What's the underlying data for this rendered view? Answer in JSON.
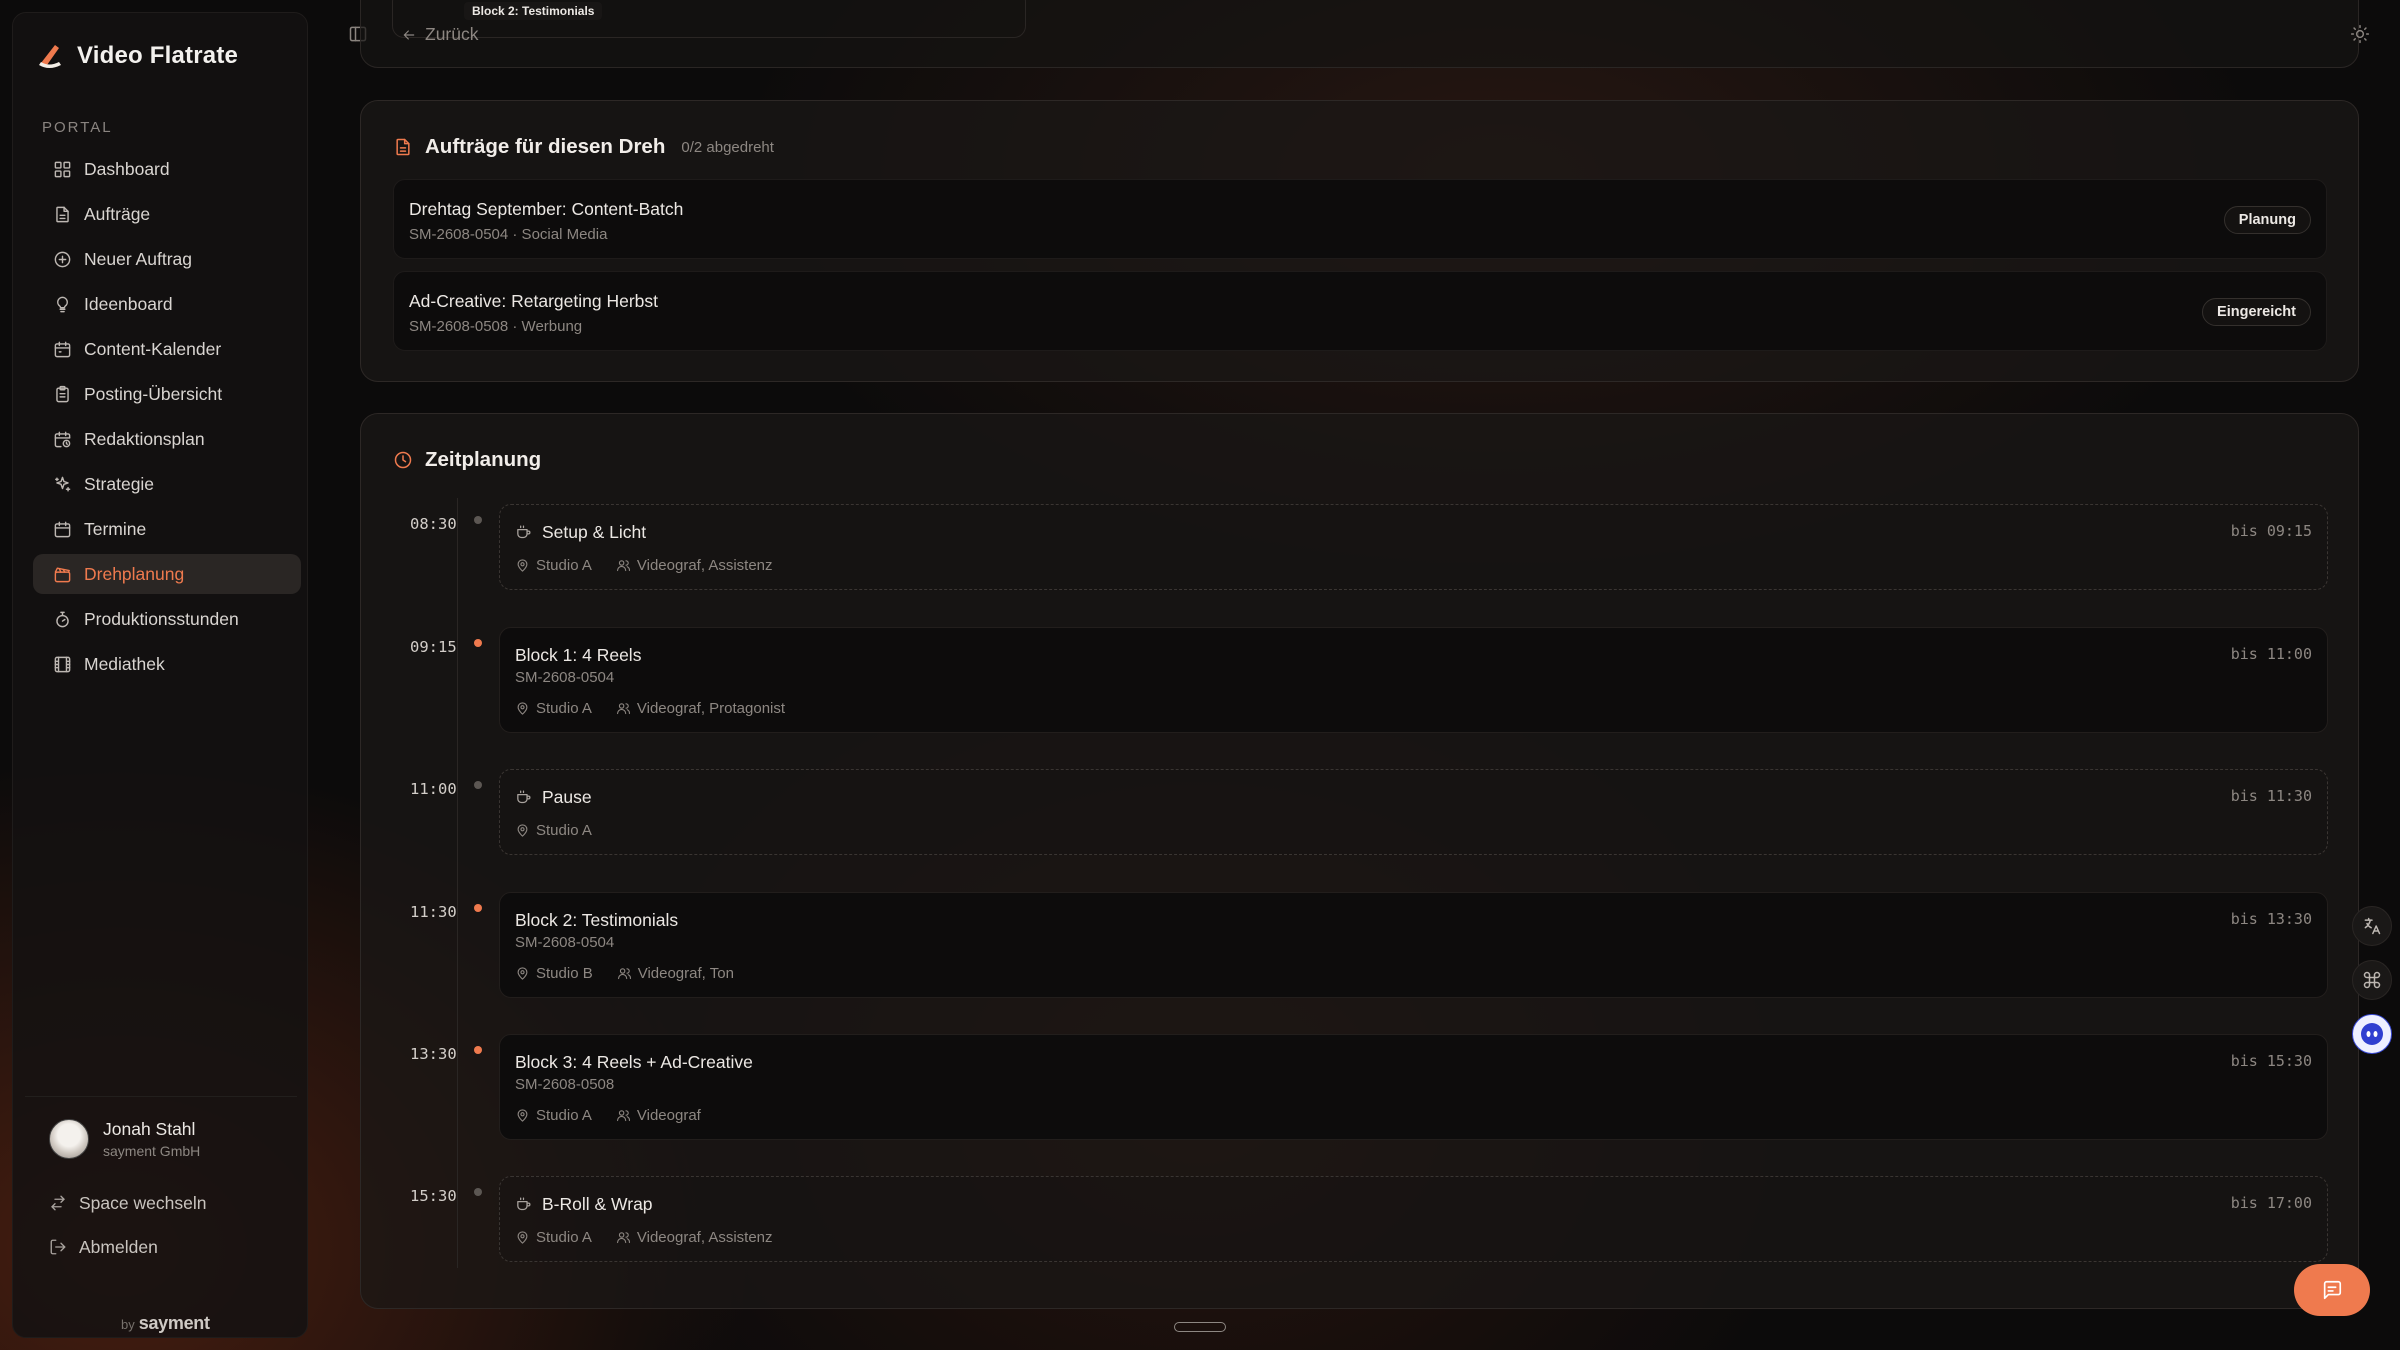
{
  "app": {
    "title": "Video Flatrate",
    "section_label": "PORTAL"
  },
  "sidebar": {
    "items": [
      {
        "label": "Dashboard",
        "icon": "grid-icon"
      },
      {
        "label": "Aufträge",
        "icon": "file-icon"
      },
      {
        "label": "Neuer Auftrag",
        "icon": "plus-circle-icon"
      },
      {
        "label": "Ideenboard",
        "icon": "lightbulb-icon"
      },
      {
        "label": "Content-Kalender",
        "icon": "calendar-icon"
      },
      {
        "label": "Posting-Übersicht",
        "icon": "clipboard-icon"
      },
      {
        "label": "Redaktionsplan",
        "icon": "calendar-clock-icon"
      },
      {
        "label": "Strategie",
        "icon": "sparkles-icon"
      },
      {
        "label": "Termine",
        "icon": "calendar-icon"
      },
      {
        "label": "Drehplanung",
        "icon": "clapperboard-icon",
        "active": true
      },
      {
        "label": "Produktionsstunden",
        "icon": "timer-icon"
      },
      {
        "label": "Mediathek",
        "icon": "film-icon"
      }
    ],
    "user": {
      "name": "Jonah Stahl",
      "org": "sayment GmbH"
    },
    "switch_space": "Space wechseln",
    "logout": "Abmelden",
    "by": "by",
    "by_brand": "sayment"
  },
  "topbar": {
    "breadcrumb_tooltip": "Block 2: Testimonials",
    "back_label": "Zurück"
  },
  "orders_card": {
    "title": "Aufträge für diesen Dreh",
    "progress": "0/2 abgedreht",
    "orders": [
      {
        "title": "Drehtag September: Content-Batch",
        "meta": "SM-2608-0504 · Social Media",
        "status": "Planung"
      },
      {
        "title": "Ad-Creative: Retargeting Herbst",
        "meta": "SM-2608-0508 · Werbung",
        "status": "Eingereicht"
      }
    ]
  },
  "schedule": {
    "title": "Zeitplanung",
    "slots": [
      {
        "time": "08:30",
        "title": "Setup & Licht",
        "code": "",
        "location": "Studio A",
        "crew": "Videograf, Assistenz",
        "until": "bis 09:15",
        "kind": "break"
      },
      {
        "time": "09:15",
        "title": "Block 1: 4 Reels",
        "code": "SM-2608-0504",
        "location": "Studio A",
        "crew": "Videograf, Protagonist",
        "until": "bis 11:00",
        "kind": "block"
      },
      {
        "time": "11:00",
        "title": "Pause",
        "code": "",
        "location": "Studio A",
        "crew": "",
        "until": "bis 11:30",
        "kind": "break"
      },
      {
        "time": "11:30",
        "title": "Block 2: Testimonials",
        "code": "SM-2608-0504",
        "location": "Studio B",
        "crew": "Videograf, Ton",
        "until": "bis 13:30",
        "kind": "block"
      },
      {
        "time": "13:30",
        "title": "Block 3: 4 Reels + Ad-Creative",
        "code": "SM-2608-0508",
        "location": "Studio A",
        "crew": "Videograf",
        "until": "bis 15:30",
        "kind": "block"
      },
      {
        "time": "15:30",
        "title": "B-Roll & Wrap",
        "code": "",
        "location": "Studio A",
        "crew": "Videograf, Assistenz",
        "until": "bis 17:00",
        "kind": "break"
      }
    ]
  },
  "colors": {
    "accent": "#ef7a4e",
    "background": "#0c0b0b",
    "card": "#0d0c0c"
  }
}
